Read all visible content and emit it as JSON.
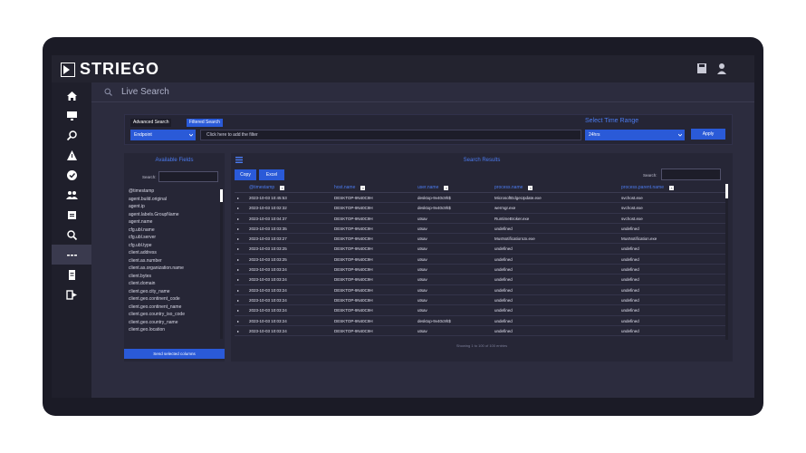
{
  "brand": {
    "name": "STRIEGO"
  },
  "header": {
    "page_title": "Live Search"
  },
  "filters": {
    "tabs": [
      "Advanced Search",
      "Filtered Search"
    ],
    "endpoint_select": "Endpoint",
    "filter_placeholder": "Click here to add the filter",
    "time_range_label": "Select Time Range",
    "time_range_value": "24hrs",
    "apply_label": "Apply"
  },
  "fields_panel": {
    "title": "Available Fields",
    "search_label": "Search:",
    "fields": [
      "@timestamp",
      "agent.build.original",
      "agent.ip",
      "agent.labels.GroupName",
      "agent.name",
      "cfg.ubl.name",
      "cfg.ubl.server",
      "cfg.ubl.type",
      "client.address",
      "client.as.number",
      "client.as.organization.name",
      "client.bytes",
      "client.domain",
      "client.geo.city_name",
      "client.geo.continent_code",
      "client.geo.continent_name",
      "client.geo.country_iso_code",
      "client.geo.country_name",
      "client.geo.location"
    ],
    "send_button": "Send selected columns"
  },
  "results": {
    "title": "Search Results",
    "copy_label": "Copy",
    "excel_label": "Excel",
    "search_label": "Search:",
    "columns": [
      "@timestamp",
      "host.name",
      "user.name",
      "process.name",
      "process.parent.name"
    ],
    "rows": [
      [
        "2023-10-03 10:45:53",
        "DESKTOP-9N40C9H",
        "desktop-9v40c9h$",
        "MicrosoftEdgeUpdate.exe",
        "svchost.exe"
      ],
      [
        "2023-10-03 10:02:32",
        "DESKTOP-9N40C9H",
        "desktop-9v40c9h$",
        "wermgr.exe",
        "svchost.exe"
      ],
      [
        "2023-10-03 10:04:37",
        "DESKTOP-9N40C9H",
        "utsav",
        "RuntimeBroker.exe",
        "svchost.exe"
      ],
      [
        "2023-10-03 10:03:35",
        "DESKTOP-9N40C9H",
        "utsav",
        "undefined",
        "undefined"
      ],
      [
        "2023-10-03 10:03:27",
        "DESKTOP-9N40C9H",
        "utsav",
        "MusNotificationUx.exe",
        "MusNotification.exe"
      ],
      [
        "2023-10-03 10:03:25",
        "DESKTOP-9N40C9H",
        "utsav",
        "undefined",
        "undefined"
      ],
      [
        "2023-10-03 10:03:25",
        "DESKTOP-9N40C9H",
        "utsav",
        "undefined",
        "undefined"
      ],
      [
        "2023-10-03 10:03:24",
        "DESKTOP-9N40C9H",
        "utsav",
        "undefined",
        "undefined"
      ],
      [
        "2023-10-03 10:03:24",
        "DESKTOP-9N40C9H",
        "utsav",
        "undefined",
        "undefined"
      ],
      [
        "2023-10-03 10:03:24",
        "DESKTOP-9N40C9H",
        "utsav",
        "undefined",
        "undefined"
      ],
      [
        "2023-10-03 10:03:24",
        "DESKTOP-9N40C9H",
        "utsav",
        "undefined",
        "undefined"
      ],
      [
        "2023-10-03 10:03:24",
        "DESKTOP-9N40C9H",
        "utsav",
        "undefined",
        "undefined"
      ],
      [
        "2023-10-03 10:03:24",
        "DESKTOP-9N40C9H",
        "desktop-9v40c9h$",
        "undefined",
        "undefined"
      ],
      [
        "2023-10-03 10:03:24",
        "DESKTOP-9N40C9H",
        "utsav",
        "undefined",
        "undefined"
      ]
    ],
    "footer": "Showing 1 to 100 of 100 entries"
  },
  "sidebar": {
    "icons": [
      "home-icon",
      "monitor-icon",
      "investigate-icon",
      "alert-icon",
      "check-circle-icon",
      "users-icon",
      "reports-icon",
      "search-icon",
      "live-search-icon",
      "document-icon",
      "logout-icon"
    ]
  },
  "colors": {
    "accent": "#2a5ad8",
    "title_blue": "#4b7bf0",
    "background": "#2c2c3e"
  }
}
